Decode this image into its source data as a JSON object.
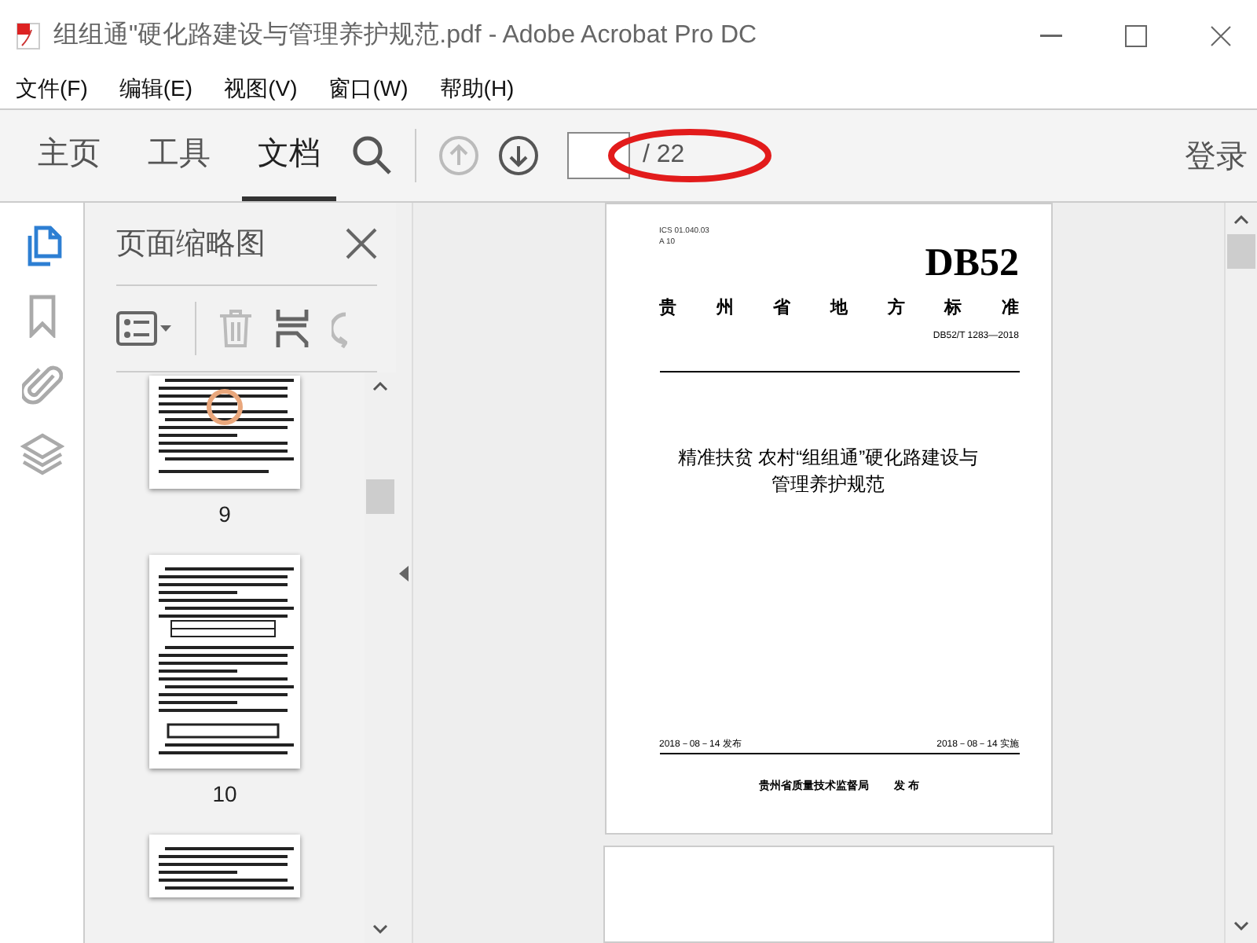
{
  "window": {
    "title": "组组通\"硬化路建设与管理养护规范.pdf - Adobe Acrobat Pro DC"
  },
  "menu": [
    "文件(F)",
    "编辑(E)",
    "视图(V)",
    "窗口(W)",
    "帮助(H)"
  ],
  "toolbar": {
    "tabs": [
      {
        "label": "主页",
        "selected": false
      },
      {
        "label": "工具",
        "selected": false
      },
      {
        "label": "文档",
        "selected": true
      }
    ],
    "page_total": "/ 22",
    "sign_in": "登录"
  },
  "side_tools": [
    {
      "kind": "pages",
      "selected": true
    },
    {
      "kind": "bookmarks",
      "selected": false
    },
    {
      "kind": "attachments",
      "selected": false
    },
    {
      "kind": "layers",
      "selected": false
    }
  ],
  "thumbnail_panel": {
    "title": "页面缩略图",
    "thumbnails": [
      {
        "label": "9",
        "kind": "text"
      },
      {
        "label": "10",
        "kind": "tables"
      }
    ]
  },
  "document": {
    "cover": {
      "codes": [
        "ICS 01.040.03",
        "A 10"
      ],
      "standard_code": "DB52",
      "authority": "贵州省地方标准",
      "number": "DB52/T 1283—2018",
      "title_lines": [
        "精准扶贫 农村“组组通”硬化路建设与",
        "管理养护规范"
      ],
      "issue_date": "2018－08－14 发布",
      "effective_date": "2018－08－14 实施",
      "issuer": "贵州省质量技术监督局",
      "issue_word": "发 布"
    }
  }
}
